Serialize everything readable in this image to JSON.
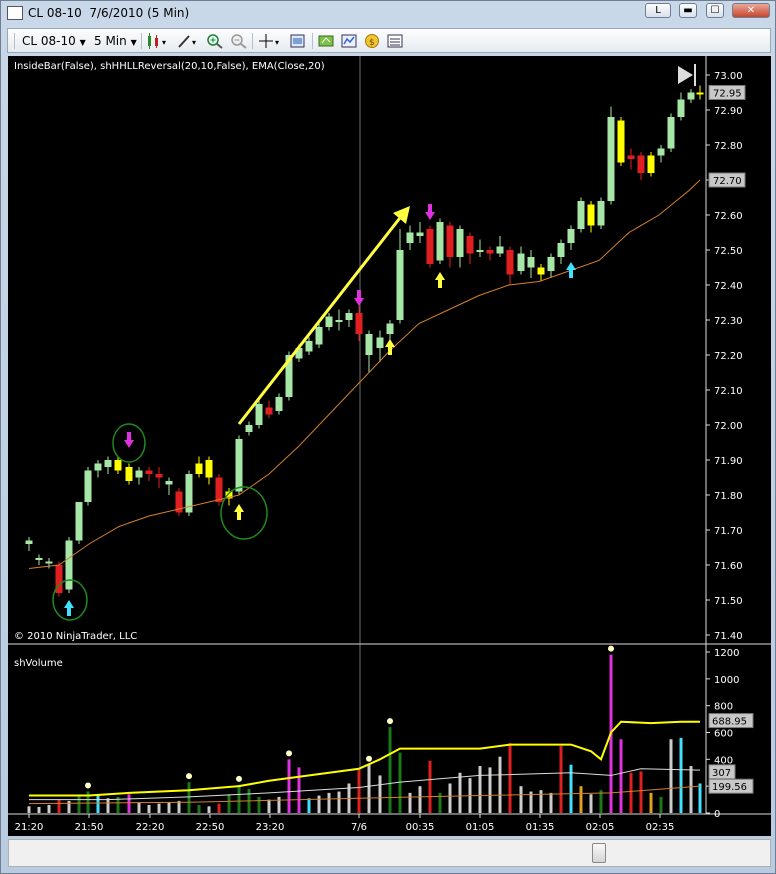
{
  "window": {
    "title": "CL 08-10  7/6/2010 (5 Min)",
    "btn_restore": "L",
    "btn_min": "▬",
    "btn_max": "☐",
    "btn_close": "✕"
  },
  "toolbar": {
    "instrument": "CL 08-10",
    "interval": "5 Min"
  },
  "chart": {
    "price_label": "InsideBar(False), shHHLLReversal(20,10,False), EMA(Close,20)",
    "copyright": "© 2010 NinjaTrader, LLC",
    "price_ticks": [
      "73.00",
      "72.90",
      "72.80",
      "72.70",
      "72.60",
      "72.50",
      "72.40",
      "72.30",
      "72.20",
      "72.10",
      "72.00",
      "71.90",
      "71.80",
      "71.70",
      "71.60",
      "71.50",
      "71.40"
    ],
    "last_price": "72.95",
    "ema_value": "72.70",
    "volume_label": "shVolume",
    "volume_ticks": [
      "1200",
      "1000",
      "800",
      "600",
      "400",
      "200",
      "0"
    ],
    "volume_flags": [
      "688.95",
      "307",
      "199.56"
    ],
    "time_ticks": [
      "21:20",
      "21:50",
      "22:20",
      "22:50",
      "23:20",
      "7/6",
      "00:35",
      "01:05",
      "01:35",
      "02:05",
      "02:35"
    ],
    "colors": {
      "up": "#a6e6a6",
      "down": "#e02020",
      "inside": "#ffff00",
      "ema": "#d2812d",
      "vol_avg": "#ffff00"
    }
  }
}
